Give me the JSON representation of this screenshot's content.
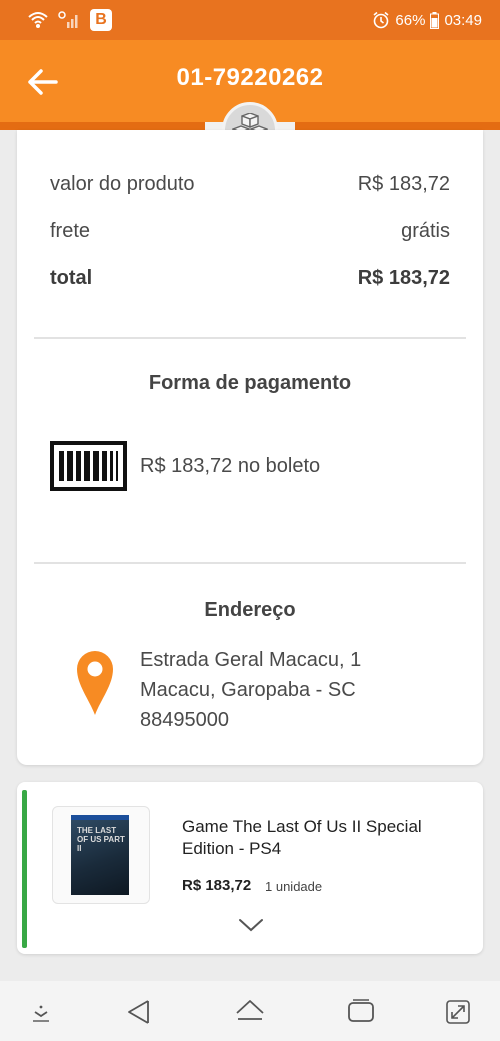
{
  "status_bar": {
    "app_badge": "B",
    "battery": "66%",
    "time": "03:49",
    "icons": [
      "wifi-icon",
      "signal-icon",
      "alarm-icon",
      "battery-icon"
    ]
  },
  "header": {
    "order_number": "01-79220262",
    "back_icon": "arrow-left-icon",
    "badge_icon": "boxes-icon",
    "color": "#f78b23"
  },
  "summary": {
    "rows": [
      {
        "label": "valor do produto",
        "value": "R$ 183,72"
      },
      {
        "label": "frete",
        "value": "grátis"
      },
      {
        "label": "total",
        "value": "R$ 183,72"
      }
    ]
  },
  "payment": {
    "title": "Forma de pagamento",
    "icon": "barcode-icon",
    "text": "R$ 183,72 no boleto"
  },
  "address": {
    "title": "Endereço",
    "icon": "location-pin-icon",
    "lines": [
      "Estrada Geral Macacu, 1",
      "Macacu, Garopaba - SC",
      "88495000"
    ]
  },
  "product": {
    "name": "Game The Last Of Us II Special Edition - PS4",
    "price": "R$ 183,72",
    "quantity": "1 unidade",
    "cover_text": "THE LAST OF US PART II",
    "expand_icon": "chevron-down-icon",
    "status_color": "#38a845"
  },
  "nav_bar": {
    "icons": [
      "keyboard-hide-icon",
      "back-icon",
      "home-icon",
      "recents-icon",
      "rotate-icon"
    ]
  }
}
